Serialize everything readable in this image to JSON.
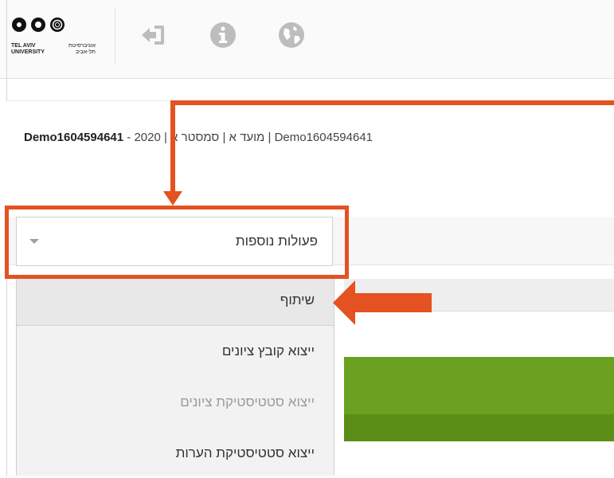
{
  "logo": {
    "left_text_1": "TEL AVIV",
    "left_text_2": "UNIVERSITY",
    "right_text_1": "אוניברסיטת",
    "right_text_2": "תל-אביב"
  },
  "header_icons": [
    {
      "icon": "sign-in-icon"
    },
    {
      "icon": "info-icon"
    },
    {
      "icon": "globe-icon"
    }
  ],
  "course": {
    "title_bold": "Demo1604594641",
    "title_rest": " - 2020 | מועד א | סמסטר א | Demo1604594641"
  },
  "dropdown": {
    "label": "פעולות נוספות"
  },
  "menu": {
    "items": [
      {
        "label": "שיתוף",
        "state": "active"
      },
      {
        "label": "ייצוא קובץ ציונים",
        "state": "normal"
      },
      {
        "label": "ייצוא סטטיסטיקת ציונים",
        "state": "disabled"
      },
      {
        "label": "ייצוא סטטיסטיקת הערות",
        "state": "normal"
      }
    ]
  },
  "colors": {
    "annotation": "#e35220",
    "progress_green": "#6aa121"
  }
}
